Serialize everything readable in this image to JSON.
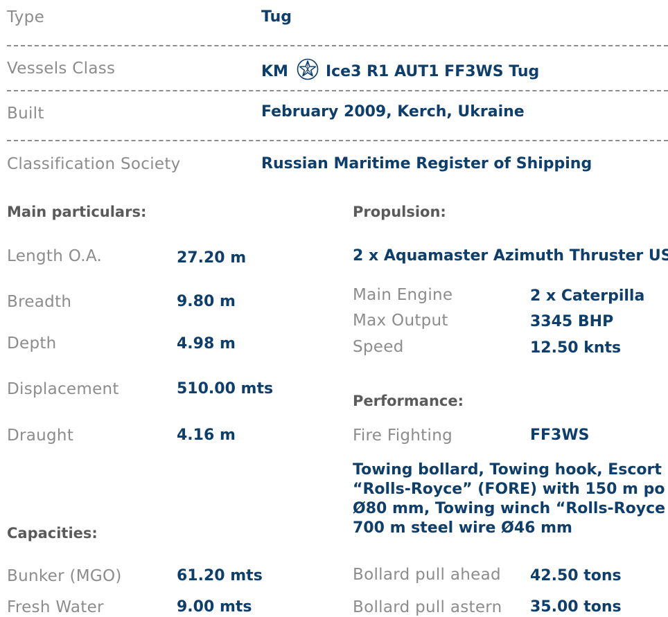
{
  "general": {
    "type_label": "Type",
    "type_value": "Tug",
    "class_label": "Vessels Class",
    "class_value_prefix": "KM",
    "class_value_suffix": "Ice3  R1 AUT1 FF3WS Tug",
    "built_label": "Built",
    "built_value": "February 2009, Kerch, Ukraine",
    "society_label": "Classification Society",
    "society_value": "Russian Maritime Register of Shipping"
  },
  "main": {
    "heading": "Main particulars:",
    "length_label": "Length O.A.",
    "length_value": "27.20 m",
    "breadth_label": "Breadth",
    "breadth_value": "9.80 m",
    "depth_label": "Depth",
    "depth_value": "4.98 m",
    "displacement_label": "Displacement",
    "displacement_value": "510.00 mts",
    "draught_label": "Draught",
    "draught_value": "4.16 m"
  },
  "capacities": {
    "heading": "Capacities:",
    "bunker_label": "Bunker (MGO)",
    "bunker_value": "61.20 mts",
    "water_label": "Fresh Water",
    "water_value": "9.00 mts"
  },
  "propulsion": {
    "heading": "Propulsion:",
    "thruster": "2 x Aquamaster Azimuth Thruster US",
    "engine_label": "Main Engine",
    "engine_value": "2 x Caterpilla",
    "output_label": "Max Output",
    "output_value": "3345 BHP",
    "speed_label": "Speed",
    "speed_value": "12.50 knts"
  },
  "performance": {
    "heading": "Performance:",
    "fire_label": "Fire Fighting",
    "fire_value": "FF3WS",
    "towing_line1": "Towing bollard, Towing hook, Escort",
    "towing_line2": "“Rolls-Royce” (FORE) with 150 m po",
    "towing_line3": "Ø80 mm, Towing winch “Rolls-Royce",
    "towing_line4": "700 m steel wire Ø46 mm",
    "ahead_label": "Bollard pull ahead",
    "ahead_value": "42.50 tons",
    "astern_label": "Bollard pull astern",
    "astern_value": "35.00 tons"
  }
}
